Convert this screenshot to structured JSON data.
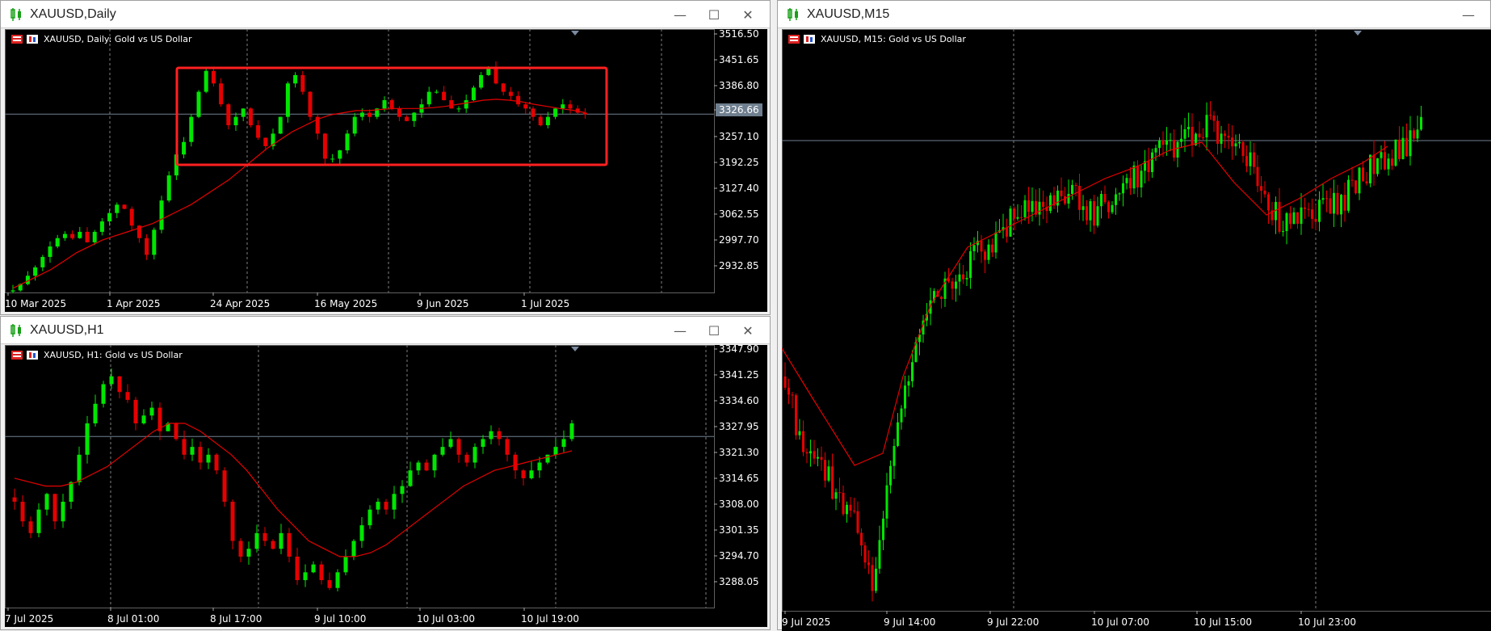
{
  "windows": {
    "daily": {
      "title": "XAUUSD,Daily",
      "info": "XAUUSD, Daily:  Gold vs US Dollar",
      "price_ticks": [
        "3516.50",
        "3451.65",
        "3386.80",
        "3326.66",
        "3257.10",
        "3192.25",
        "3127.40",
        "3062.55",
        "2997.70",
        "2932.85"
      ],
      "current_price": "3326.66",
      "date_labels": [
        "10 Mar 2025",
        "1 Apr 2025",
        "24 Apr 2025",
        "16 May 2025",
        "9 Jun 2025",
        "1 Jul 2025"
      ],
      "highlight": "range box"
    },
    "h1": {
      "title": "XAUUSD,H1",
      "info": "XAUUSD, H1:  Gold vs US Dollar",
      "price_ticks": [
        "3347.90",
        "3341.25",
        "3334.60",
        "3327.95",
        "3321.30",
        "3314.65",
        "3308.00",
        "3301.35",
        "3294.70",
        "3288.05"
      ],
      "current_price": "3326.66",
      "date_labels": [
        "7 Jul 2025",
        "8 Jul 01:00",
        "8 Jul 17:00",
        "9 Jul 10:00",
        "10 Jul 03:00",
        "10 Jul 19:00"
      ]
    },
    "m15": {
      "title": "XAUUSD,M15",
      "info": "XAUUSD, M15:  Gold vs US Dollar",
      "date_labels": [
        "9 Jul 2025",
        "9 Jul 14:00",
        "9 Jul 22:00",
        "10 Jul 07:00",
        "10 Jul 15:00",
        "10 Jul 23:00"
      ]
    }
  },
  "window_controls": {
    "minimize": "—",
    "maximize": "☐",
    "close": "✕"
  },
  "colors": {
    "bull": "#00e600",
    "bear": "#e60000",
    "ma": "#e60000",
    "highlight_box": "#ff2020",
    "grid": "#808080",
    "price_line": "#708090"
  },
  "chart_data": [
    {
      "type": "candlestick",
      "title": "XAUUSD, Daily:  Gold vs US Dollar",
      "x": [
        "10 Mar 2025",
        "1 Apr 2025",
        "24 Apr 2025",
        "16 May 2025",
        "9 Jun 2025",
        "1 Jul 2025"
      ],
      "ylim": [
        2900,
        3530
      ],
      "close_series": [
        2905,
        2920,
        2940,
        2960,
        2985,
        3010,
        3030,
        3040,
        3030,
        3045,
        3020,
        3045,
        3070,
        3090,
        3110,
        3100,
        3060,
        3030,
        2990,
        3050,
        3120,
        3180,
        3230,
        3260,
        3320,
        3380,
        3430,
        3400,
        3350,
        3300,
        3320,
        3340,
        3300,
        3270,
        3250,
        3280,
        3320,
        3400,
        3420,
        3380,
        3320,
        3280,
        3220,
        3220,
        3240,
        3280,
        3320,
        3330,
        3320,
        3340,
        3360,
        3340,
        3320,
        3310,
        3330,
        3350,
        3380,
        3380,
        3360,
        3340,
        3340,
        3360,
        3390,
        3420,
        3440,
        3400,
        3380,
        3370,
        3350,
        3340,
        3320,
        3300,
        3320,
        3340,
        3350,
        3340,
        3330,
        3326
      ],
      "ma_series": [
        2910,
        2925,
        2940,
        2955,
        2975,
        2995,
        3010,
        3025,
        3035,
        3045,
        3055,
        3065,
        3080,
        3095,
        3110,
        3130,
        3150,
        3170,
        3195,
        3220,
        3245,
        3265,
        3285,
        3300,
        3315,
        3325,
        3330,
        3335,
        3335,
        3338,
        3340,
        3340,
        3340,
        3342,
        3345,
        3350,
        3355,
        3360,
        3362,
        3360,
        3356,
        3350,
        3345,
        3340,
        3336,
        3330
      ]
    },
    {
      "type": "candlestick",
      "title": "XAUUSD, H1:  Gold vs US Dollar",
      "x": [
        "7 Jul 2025",
        "8 Jul 01:00",
        "8 Jul 17:00",
        "9 Jul 10:00",
        "10 Jul 03:00",
        "10 Jul 19:00"
      ],
      "ylim": [
        3283,
        3350
      ],
      "close_series": [
        3310,
        3305,
        3302,
        3308,
        3312,
        3305,
        3310,
        3315,
        3322,
        3330,
        3335,
        3340,
        3342,
        3338,
        3336,
        3330,
        3332,
        3334,
        3328,
        3330,
        3326,
        3322,
        3324,
        3320,
        3322,
        3318,
        3310,
        3300,
        3296,
        3298,
        3302,
        3300,
        3298,
        3302,
        3296,
        3290,
        3292,
        3294,
        3290,
        3288,
        3292,
        3296,
        3300,
        3304,
        3308,
        3310,
        3308,
        3312,
        3314,
        3318,
        3320,
        3318,
        3322,
        3324,
        3326,
        3322,
        3320,
        3324,
        3326,
        3328,
        3326,
        3322,
        3318,
        3316,
        3318,
        3320,
        3322,
        3324,
        3326,
        3330
      ],
      "ma_series": [
        3316,
        3315,
        3314,
        3314,
        3315,
        3317,
        3319,
        3322,
        3325,
        3328,
        3330,
        3330,
        3328,
        3325,
        3322,
        3318,
        3313,
        3308,
        3304,
        3300,
        3298,
        3296,
        3296,
        3297,
        3299,
        3302,
        3305,
        3308,
        3311,
        3314,
        3316,
        3318,
        3319,
        3320,
        3321,
        3322,
        3323
      ]
    },
    {
      "type": "candlestick",
      "title": "XAUUSD, M15:  Gold vs US Dollar",
      "x": [
        "9 Jul 2025",
        "9 Jul 14:00",
        "9 Jul 22:00",
        "10 Jul 07:00",
        "10 Jul 15:00",
        "10 Jul 23:00"
      ]
    }
  ]
}
